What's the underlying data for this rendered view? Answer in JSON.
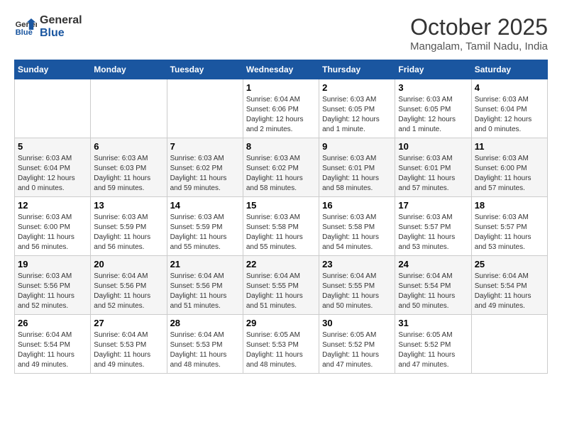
{
  "header": {
    "logo_general": "General",
    "logo_blue": "Blue",
    "month_title": "October 2025",
    "subtitle": "Mangalam, Tamil Nadu, India"
  },
  "calendar": {
    "days_of_week": [
      "Sunday",
      "Monday",
      "Tuesday",
      "Wednesday",
      "Thursday",
      "Friday",
      "Saturday"
    ],
    "weeks": [
      [
        {
          "day": "",
          "info": ""
        },
        {
          "day": "",
          "info": ""
        },
        {
          "day": "",
          "info": ""
        },
        {
          "day": "1",
          "info": "Sunrise: 6:04 AM\nSunset: 6:06 PM\nDaylight: 12 hours\nand 2 minutes."
        },
        {
          "day": "2",
          "info": "Sunrise: 6:03 AM\nSunset: 6:05 PM\nDaylight: 12 hours\nand 1 minute."
        },
        {
          "day": "3",
          "info": "Sunrise: 6:03 AM\nSunset: 6:05 PM\nDaylight: 12 hours\nand 1 minute."
        },
        {
          "day": "4",
          "info": "Sunrise: 6:03 AM\nSunset: 6:04 PM\nDaylight: 12 hours\nand 0 minutes."
        }
      ],
      [
        {
          "day": "5",
          "info": "Sunrise: 6:03 AM\nSunset: 6:04 PM\nDaylight: 12 hours\nand 0 minutes."
        },
        {
          "day": "6",
          "info": "Sunrise: 6:03 AM\nSunset: 6:03 PM\nDaylight: 11 hours\nand 59 minutes."
        },
        {
          "day": "7",
          "info": "Sunrise: 6:03 AM\nSunset: 6:02 PM\nDaylight: 11 hours\nand 59 minutes."
        },
        {
          "day": "8",
          "info": "Sunrise: 6:03 AM\nSunset: 6:02 PM\nDaylight: 11 hours\nand 58 minutes."
        },
        {
          "day": "9",
          "info": "Sunrise: 6:03 AM\nSunset: 6:01 PM\nDaylight: 11 hours\nand 58 minutes."
        },
        {
          "day": "10",
          "info": "Sunrise: 6:03 AM\nSunset: 6:01 PM\nDaylight: 11 hours\nand 57 minutes."
        },
        {
          "day": "11",
          "info": "Sunrise: 6:03 AM\nSunset: 6:00 PM\nDaylight: 11 hours\nand 57 minutes."
        }
      ],
      [
        {
          "day": "12",
          "info": "Sunrise: 6:03 AM\nSunset: 6:00 PM\nDaylight: 11 hours\nand 56 minutes."
        },
        {
          "day": "13",
          "info": "Sunrise: 6:03 AM\nSunset: 5:59 PM\nDaylight: 11 hours\nand 56 minutes."
        },
        {
          "day": "14",
          "info": "Sunrise: 6:03 AM\nSunset: 5:59 PM\nDaylight: 11 hours\nand 55 minutes."
        },
        {
          "day": "15",
          "info": "Sunrise: 6:03 AM\nSunset: 5:58 PM\nDaylight: 11 hours\nand 55 minutes."
        },
        {
          "day": "16",
          "info": "Sunrise: 6:03 AM\nSunset: 5:58 PM\nDaylight: 11 hours\nand 54 minutes."
        },
        {
          "day": "17",
          "info": "Sunrise: 6:03 AM\nSunset: 5:57 PM\nDaylight: 11 hours\nand 53 minutes."
        },
        {
          "day": "18",
          "info": "Sunrise: 6:03 AM\nSunset: 5:57 PM\nDaylight: 11 hours\nand 53 minutes."
        }
      ],
      [
        {
          "day": "19",
          "info": "Sunrise: 6:03 AM\nSunset: 5:56 PM\nDaylight: 11 hours\nand 52 minutes."
        },
        {
          "day": "20",
          "info": "Sunrise: 6:04 AM\nSunset: 5:56 PM\nDaylight: 11 hours\nand 52 minutes."
        },
        {
          "day": "21",
          "info": "Sunrise: 6:04 AM\nSunset: 5:56 PM\nDaylight: 11 hours\nand 51 minutes."
        },
        {
          "day": "22",
          "info": "Sunrise: 6:04 AM\nSunset: 5:55 PM\nDaylight: 11 hours\nand 51 minutes."
        },
        {
          "day": "23",
          "info": "Sunrise: 6:04 AM\nSunset: 5:55 PM\nDaylight: 11 hours\nand 50 minutes."
        },
        {
          "day": "24",
          "info": "Sunrise: 6:04 AM\nSunset: 5:54 PM\nDaylight: 11 hours\nand 50 minutes."
        },
        {
          "day": "25",
          "info": "Sunrise: 6:04 AM\nSunset: 5:54 PM\nDaylight: 11 hours\nand 49 minutes."
        }
      ],
      [
        {
          "day": "26",
          "info": "Sunrise: 6:04 AM\nSunset: 5:54 PM\nDaylight: 11 hours\nand 49 minutes."
        },
        {
          "day": "27",
          "info": "Sunrise: 6:04 AM\nSunset: 5:53 PM\nDaylight: 11 hours\nand 49 minutes."
        },
        {
          "day": "28",
          "info": "Sunrise: 6:04 AM\nSunset: 5:53 PM\nDaylight: 11 hours\nand 48 minutes."
        },
        {
          "day": "29",
          "info": "Sunrise: 6:05 AM\nSunset: 5:53 PM\nDaylight: 11 hours\nand 48 minutes."
        },
        {
          "day": "30",
          "info": "Sunrise: 6:05 AM\nSunset: 5:52 PM\nDaylight: 11 hours\nand 47 minutes."
        },
        {
          "day": "31",
          "info": "Sunrise: 6:05 AM\nSunset: 5:52 PM\nDaylight: 11 hours\nand 47 minutes."
        },
        {
          "day": "",
          "info": ""
        }
      ]
    ]
  }
}
